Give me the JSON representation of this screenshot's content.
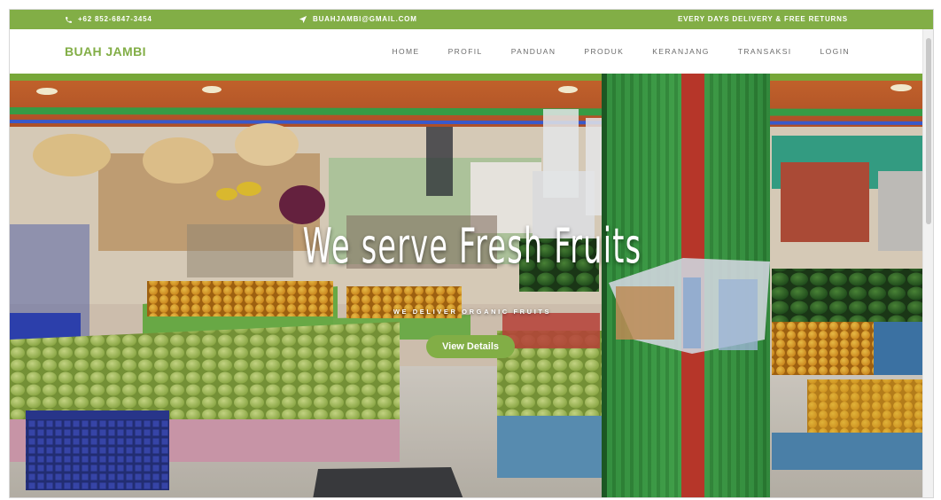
{
  "topbar": {
    "phone": "+62 852-6847-3454",
    "email": "BUAHJAMBI@GMAIL.COM",
    "delivery": "EVERY DAYS DELIVERY & FREE RETURNS",
    "phone_icon": "phone-icon",
    "email_icon": "paper-plane-icon"
  },
  "navbar": {
    "brand": "BUAH JAMBI",
    "items": [
      {
        "label": "HOME"
      },
      {
        "label": "PROFIL"
      },
      {
        "label": "PANDUAN"
      },
      {
        "label": "PRODUK"
      },
      {
        "label": "KERANJANG"
      },
      {
        "label": "TRANSAKSI"
      },
      {
        "label": "LOGIN"
      }
    ]
  },
  "hero": {
    "title": "We serve Fresh Fruits",
    "subtitle": "WE DELIVER ORGANIC FRUITS",
    "button": "View Details"
  },
  "colors": {
    "accent": "#82ae46",
    "nav_text": "#6b6b6b"
  }
}
